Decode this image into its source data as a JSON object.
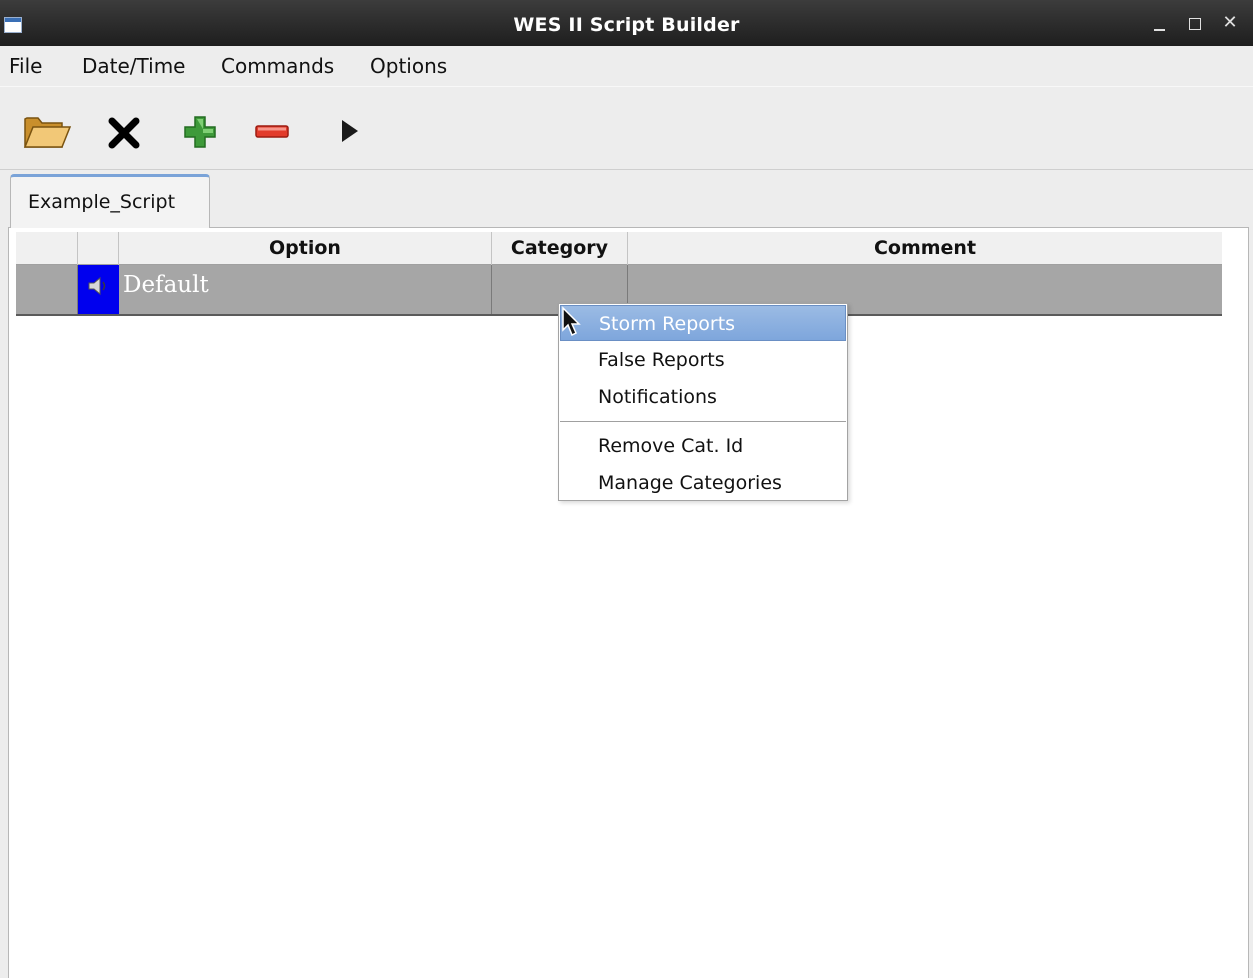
{
  "window": {
    "title": "WES II Script Builder",
    "controls": {
      "minimize_icon": "minimize-icon",
      "maximize_icon": "maximize-icon",
      "close_icon": "close-icon"
    }
  },
  "menubar": {
    "items": [
      "File",
      "Date/Time",
      "Commands",
      "Options"
    ]
  },
  "toolbar": {
    "buttons": [
      {
        "icon": "folder-open-icon"
      },
      {
        "icon": "close-x-icon"
      },
      {
        "icon": "add-plus-icon"
      },
      {
        "icon": "remove-minus-icon"
      },
      {
        "icon": "play-icon"
      }
    ]
  },
  "tabs": [
    {
      "label": "Example_Script",
      "active": true
    }
  ],
  "table": {
    "columns": [
      "",
      "",
      "Option",
      "Category",
      "Comment"
    ],
    "rows": [
      {
        "icon": "speaker-icon",
        "option": "Default",
        "category": "",
        "comment": "",
        "selected": true
      }
    ]
  },
  "context_menu": {
    "items": [
      {
        "label": "Storm Reports",
        "highlighted": true
      },
      {
        "label": "False Reports",
        "highlighted": false
      },
      {
        "label": "Notifications",
        "highlighted": false
      },
      {
        "label": "Remove Cat. Id",
        "highlighted": false
      },
      {
        "label": "Manage Categories",
        "highlighted": false
      }
    ]
  },
  "colors": {
    "titlebar": "#2b2b2b",
    "row_selected": "#a6a6a6",
    "icon_cell": "#0000ee",
    "menu_highlight": "#8eb1e0"
  }
}
